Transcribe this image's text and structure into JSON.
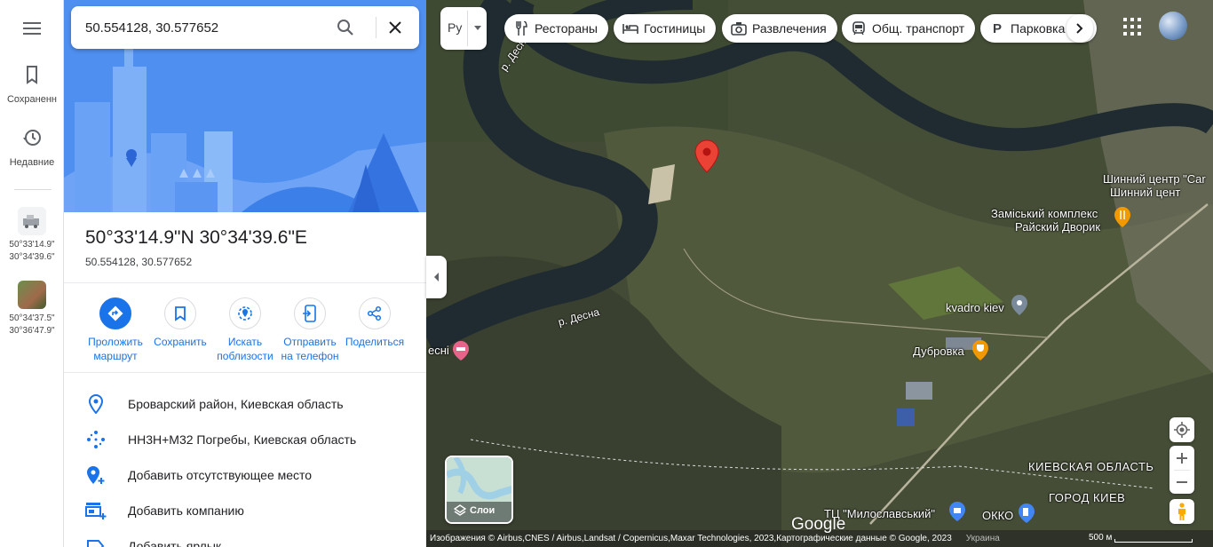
{
  "search": {
    "value": "50.554128, 30.577652"
  },
  "rail": {
    "saved_label": "Сохраненн",
    "recent_label": "Недавние",
    "recents": [
      {
        "lat": "50°33'14.9\"",
        "lng": "30°34'39.6\""
      },
      {
        "lat": "50°34'37.5\"",
        "lng": "30°36'47.9\""
      }
    ]
  },
  "place": {
    "title": "50°33'14.9\"N 30°34'39.6\"E",
    "decimal": "50.554128, 30.577652"
  },
  "actions": [
    {
      "label_l1": "Проложить",
      "label_l2": "маршрут"
    },
    {
      "label_l1": "Сохранить",
      "label_l2": ""
    },
    {
      "label_l1": "Искать",
      "label_l2": "поблизости"
    },
    {
      "label_l1": "Отправить",
      "label_l2": "на телефон"
    },
    {
      "label_l1": "Поделиться",
      "label_l2": ""
    }
  ],
  "info": [
    {
      "icon": "location-pin-icon",
      "text": "Броварский район, Киевская область"
    },
    {
      "icon": "plus-code-icon",
      "text": "HH3H+M32 Погребы, Киевская область"
    },
    {
      "icon": "add-place-icon",
      "text": "Добавить отсутствующее место"
    },
    {
      "icon": "add-business-icon",
      "text": "Добавить компанию"
    },
    {
      "icon": "label-icon",
      "text": "Добавить ярлык"
    }
  ],
  "map": {
    "direction_label": "Ру",
    "chips": [
      {
        "icon": "restaurant-icon",
        "label": "Рестораны"
      },
      {
        "icon": "hotel-icon",
        "label": "Гостиницы"
      },
      {
        "icon": "camera-icon",
        "label": "Развлечения"
      },
      {
        "icon": "transit-icon",
        "label": "Общ. транспорт"
      },
      {
        "icon": "parking-icon",
        "label": "Парковка"
      }
    ],
    "labels": {
      "river_top": "р. Десна",
      "river_mid": "р. Десна",
      "left_edge": "есні",
      "tyre1": "Шинний центр \"Car",
      "tyre2": "Шинний цент",
      "complex1": "Заміський комплекс",
      "complex2": "Райский Дворик",
      "kvadro": "kvadro kiev",
      "dubrovka": "Дубровка",
      "oblast": "КИЕВСКАЯ ОБЛАСТЬ",
      "city": "ГОРОД КИЕВ",
      "mall": "ТЦ \"Милославський\"",
      "okko": "ОККО"
    },
    "layers_label": "Слои",
    "logo": "Google",
    "attribution": "Изображения © Airbus,CNES / Airbus,Landsat / Copernicus,Maxar Technologies, 2023,Картографические данные © Google, 2023",
    "country": "Украина",
    "scale": "500 м"
  },
  "colors": {
    "accent": "#1a73e8",
    "pin": "#ea4335"
  }
}
